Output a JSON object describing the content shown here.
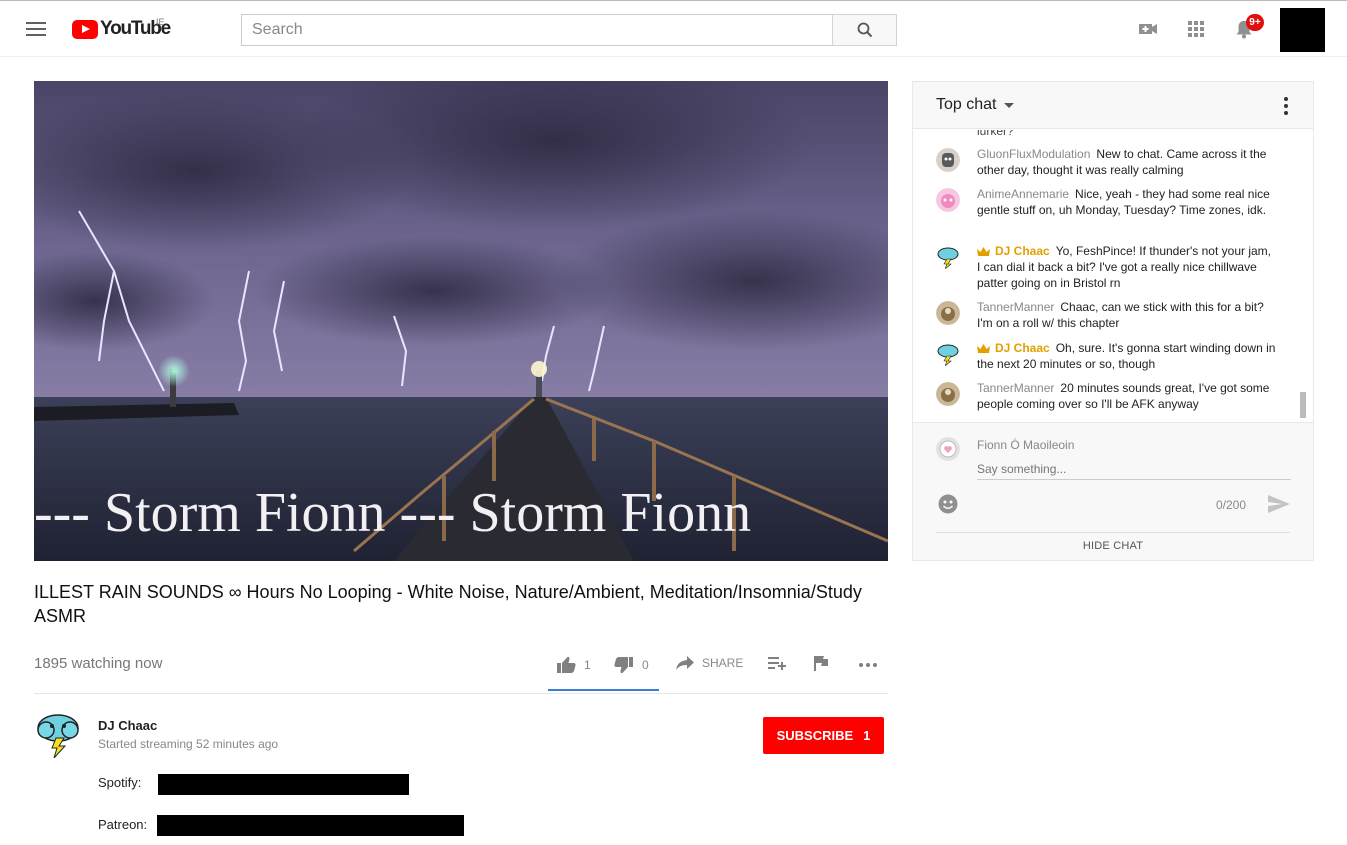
{
  "header": {
    "logo_text": "YouTube",
    "country": "IE",
    "search_placeholder": "Search",
    "notification_badge": "9+"
  },
  "video": {
    "overlay_text": "--- Storm Fionn --- Storm Fionn",
    "title": "ILLEST RAIN SOUNDS ∞ Hours No Looping - White Noise, Nature/Ambient, Meditation/Insomnia/Study ASMR",
    "watching": "1895 watching now",
    "likes": "1",
    "dislikes": "0",
    "share_label": "SHARE"
  },
  "channel": {
    "name": "DJ Chaac",
    "started": "Started streaming 52 minutes ago",
    "subscribe_label": "SUBSCRIBE",
    "subscriber_count": "1"
  },
  "description": {
    "spotify_label": "Spotify:",
    "patreon_label": "Patreon:"
  },
  "chat": {
    "title": "Top chat",
    "cut_text": "lurker?",
    "messages": [
      {
        "author": "GluonFluxModulation",
        "text": "New to chat. Came across it the other day, thought it was really calming",
        "owner": false
      },
      {
        "author": "AnimeAnnemarie",
        "text": "Nice, yeah - they had some real nice gentle stuff on, uh Monday, Tuesday? Time zones, idk.",
        "owner": false
      },
      {
        "author": "DJ Chaac",
        "text": "Yo, FeshPince! If thunder's not your jam, I can dial it back a bit? I've got a really nice chillwave patter going on in Bristol rn",
        "owner": true
      },
      {
        "author": "TannerManner",
        "text": "Chaac, can we stick with this for a bit? I'm on a roll w/ this chapter",
        "owner": false
      },
      {
        "author": "DJ Chaac",
        "text": "Oh, sure. It's gonna start winding down in the next 20 minutes or so, though",
        "owner": true
      },
      {
        "author": "TannerManner",
        "text": "20 minutes sounds great, I've got some people coming over so I'll be AFK anyway",
        "owner": false
      }
    ],
    "current_user": "Fionn Ó Maoileoin",
    "input_placeholder": "Say something...",
    "counter": "0/200",
    "hide_label": "HIDE CHAT"
  },
  "colors": {
    "brand_red": "#ff0000",
    "owner_gold": "#e2a000",
    "like_blue": "#3a7fd0"
  }
}
